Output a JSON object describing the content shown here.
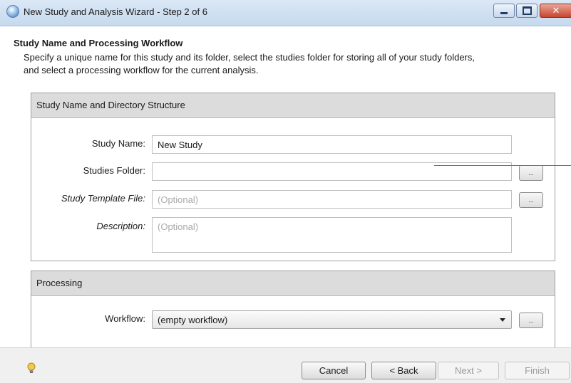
{
  "window": {
    "title": "New Study and Analysis Wizard - Step 2 of 6",
    "close_label": "✕"
  },
  "header": {
    "title": "Study Name and Processing Workflow",
    "description_line1": "Specify a unique name for this study and its folder, select the studies folder for storing all of your study folders,",
    "description_line2": "and select a processing workflow for the current analysis."
  },
  "study_group": {
    "title": "Study Name and Directory Structure",
    "study_name_label": "Study Name:",
    "study_name_value": "New Study",
    "studies_folder_label": "Studies Folder:",
    "studies_folder_value": "",
    "template_label": "Study Template File:",
    "template_placeholder": "(Optional)",
    "description_label": "Description:",
    "description_placeholder": "(Optional)",
    "browse_label": "..."
  },
  "processing_group": {
    "title": "Processing",
    "workflow_label": "Workflow:",
    "workflow_value": "(empty workflow)",
    "browse_label": "..."
  },
  "footer": {
    "cancel_label": "Cancel",
    "back_label": "< Back",
    "next_label": "Next >",
    "finish_label": "Finish"
  },
  "icons": {
    "app": "wizard-globe-icon",
    "hint": "lightbulb-icon"
  },
  "colors": {
    "close_button": "#c8452e",
    "callout_line": "#3a8599"
  }
}
